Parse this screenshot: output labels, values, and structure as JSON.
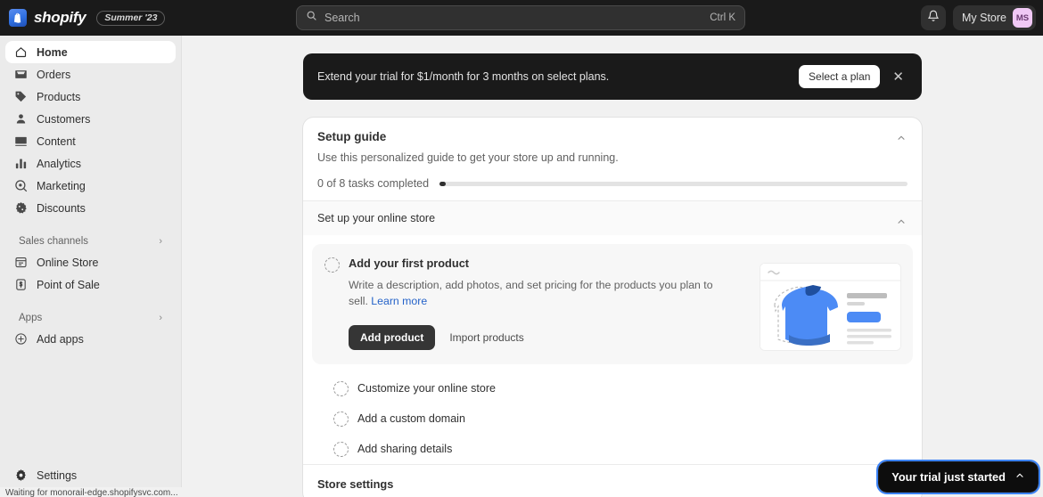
{
  "topbar": {
    "brand_name": "shopify",
    "brand_mark": "s",
    "season_badge": "Summer '23",
    "search_placeholder": "Search",
    "search_shortcut": "Ctrl K",
    "store_name": "My Store",
    "avatar_initials": "MS",
    "notification_icon": "bell-icon"
  },
  "sidebar": {
    "items": [
      {
        "label": "Home",
        "icon": "home-icon",
        "active": true
      },
      {
        "label": "Orders",
        "icon": "orders-icon",
        "active": false
      },
      {
        "label": "Products",
        "icon": "tag-icon",
        "active": false
      },
      {
        "label": "Customers",
        "icon": "person-icon",
        "active": false
      },
      {
        "label": "Content",
        "icon": "content-icon",
        "active": false
      },
      {
        "label": "Analytics",
        "icon": "bar-chart-icon",
        "active": false
      },
      {
        "label": "Marketing",
        "icon": "target-icon",
        "active": false
      },
      {
        "label": "Discounts",
        "icon": "discount-icon",
        "active": false
      }
    ],
    "sales_channels": {
      "heading": "Sales channels",
      "items": [
        {
          "label": "Online Store",
          "icon": "store-icon"
        },
        {
          "label": "Point of Sale",
          "icon": "pos-icon"
        }
      ]
    },
    "apps": {
      "heading": "Apps",
      "items": [
        {
          "label": "Add apps",
          "icon": "plus-circle-icon"
        }
      ]
    },
    "settings_label": "Settings"
  },
  "status_bar": {
    "text": "Waiting for monorail-edge.shopifysvc.com..."
  },
  "promo": {
    "message": "Extend your trial for $1/month for 3 months on select plans.",
    "button_label": "Select a plan",
    "close_icon": "close-icon"
  },
  "setup_guide": {
    "title": "Setup guide",
    "subtitle": "Use this personalized guide to get your store up and running.",
    "progress_label": "0 of 8 tasks completed",
    "tasks_completed": 0,
    "tasks_total": 8,
    "collapse_icon": "chevron-up-icon",
    "section": {
      "title": "Set up your online store",
      "collapse_icon": "chevron-up-icon"
    },
    "active_task": {
      "title": "Add your first product",
      "description": "Write a description, add photos, and set pricing for the products you plan to sell.",
      "link_label": "Learn more",
      "primary_button": "Add product",
      "secondary_button": "Import products",
      "illustration": "product-page-tshirt-illustration"
    },
    "other_tasks": [
      {
        "label": "Customize your online store"
      },
      {
        "label": "Add a custom domain"
      },
      {
        "label": "Add sharing details"
      }
    ],
    "store_settings_heading": "Store settings"
  },
  "trial_widget": {
    "label": "Your trial just started",
    "chevron_icon": "chevron-up-icon"
  },
  "colors": {
    "topbar_bg": "#1a1a1a",
    "sidebar_bg": "#ebebeb",
    "page_bg": "#f1f1f1",
    "accent_blue": "#2563c9",
    "avatar_bg": "#f0c8f5",
    "focus_ring": "#3b82f6"
  }
}
